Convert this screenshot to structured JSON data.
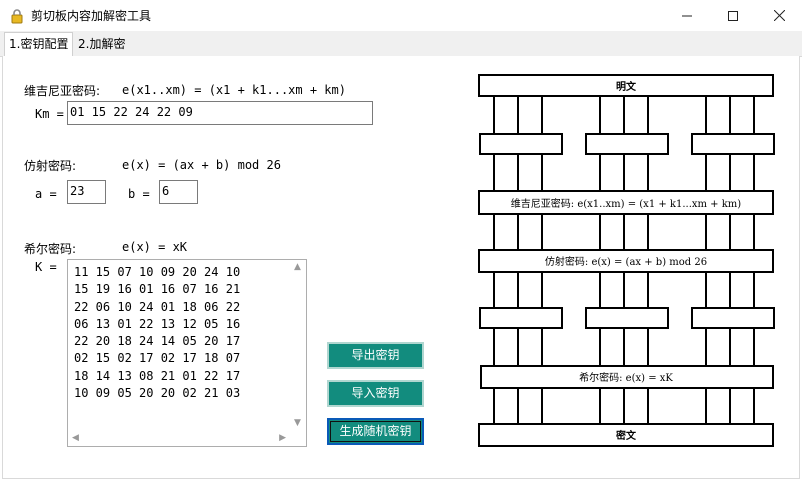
{
  "window": {
    "title": "剪切板内容加解密工具"
  },
  "tabs": [
    {
      "label": "1.密钥配置",
      "active": true
    },
    {
      "label": "2.加解密",
      "active": false
    }
  ],
  "vigenere": {
    "label": "维吉尼亚密码:",
    "formula": "e(x1..xm) = (x1 + k1...xm + km)",
    "km_label": "Km =",
    "km_value": "01 15 22 24 22 09"
  },
  "affine": {
    "label": "仿射密码:",
    "formula": "e(x) = (ax + b) mod 26",
    "a_label": "a =",
    "a_value": "23",
    "b_label": "b =",
    "b_value": "6"
  },
  "hill": {
    "label": "希尔密码:",
    "formula": "e(x) = xK",
    "k_label": "K =",
    "matrix": "11 15 07 10 09 20 24 10\n15 19 16 01 16 07 16 21\n22 06 10 24 01 18 06 22\n06 13 01 22 13 12 05 16\n22 20 18 24 14 05 20 17\n02 15 02 17 02 17 18 07\n18 14 13 08 21 01 22 17\n10 09 05 20 20 02 21 03"
  },
  "buttons": {
    "export": "导出密钥",
    "import": "导入密钥",
    "generate": "生成随机密钥"
  },
  "diagram": {
    "top": "明文",
    "vigenere": "维吉尼亚密码: e(x1..xm) = (x1 + k1...xm + km)",
    "affine": "仿射密码: e(x) = (ax + b) mod 26",
    "hill": "希尔密码: e(x) = xK",
    "bottom": "密文"
  }
}
